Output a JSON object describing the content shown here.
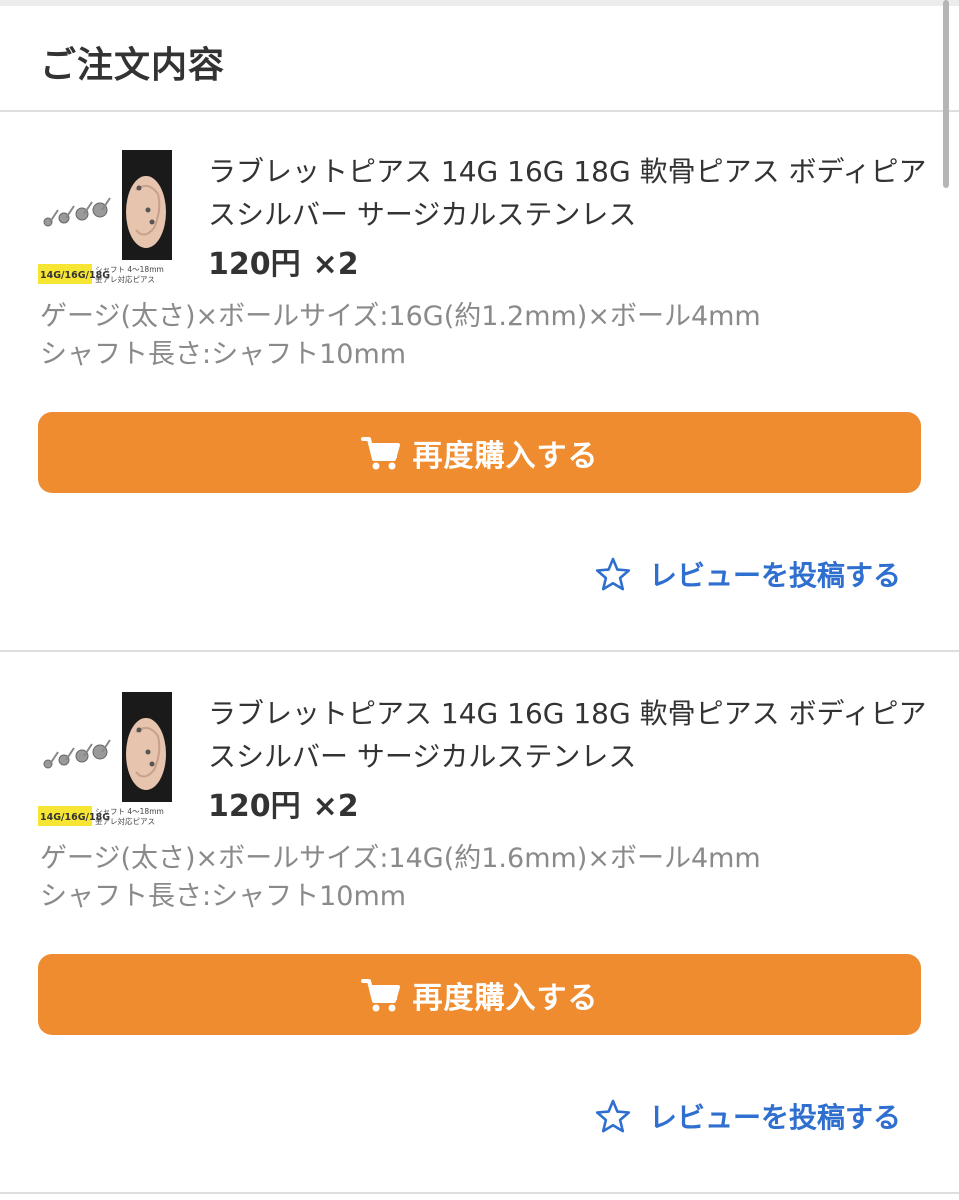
{
  "header": {
    "title": "ご注文内容"
  },
  "items": [
    {
      "title": "ラブレットピアス 14G 16G 18G 軟骨ピアス ボディピアスシルバー サージカルステンレス",
      "price": "120円",
      "quantity": "×2",
      "option_gauge": "ゲージ(太さ)×ボールサイズ:16G(約1.2mm)×ボール4mm",
      "option_shaft": "シャフト長さ:シャフト10mm",
      "thumb_badge": "14G/16G/18G",
      "thumb_caption_1": "シャフト 4～18mm",
      "thumb_caption_2": "金アレ対応ピアス",
      "rebuy_label": "再度購入する",
      "review_label": "レビューを投稿する"
    },
    {
      "title": "ラブレットピアス 14G 16G 18G 軟骨ピアス ボディピアスシルバー サージカルステンレス",
      "price": "120円",
      "quantity": "×2",
      "option_gauge": "ゲージ(太さ)×ボールサイズ:14G(約1.6mm)×ボール4mm",
      "option_shaft": "シャフト長さ:シャフト10mm",
      "thumb_badge": "14G/16G/18G",
      "thumb_caption_1": "シャフト 4～18mm",
      "thumb_caption_2": "金アレ対応ピアス",
      "rebuy_label": "再度購入する",
      "review_label": "レビューを投稿する"
    }
  ],
  "colors": {
    "accent_orange": "#f08c30",
    "link_blue": "#2f6fcf",
    "text_dark": "#333333",
    "text_muted": "#8a8a8a"
  },
  "icons": {
    "cart": "cart-icon",
    "review": "star-outline-icon"
  }
}
